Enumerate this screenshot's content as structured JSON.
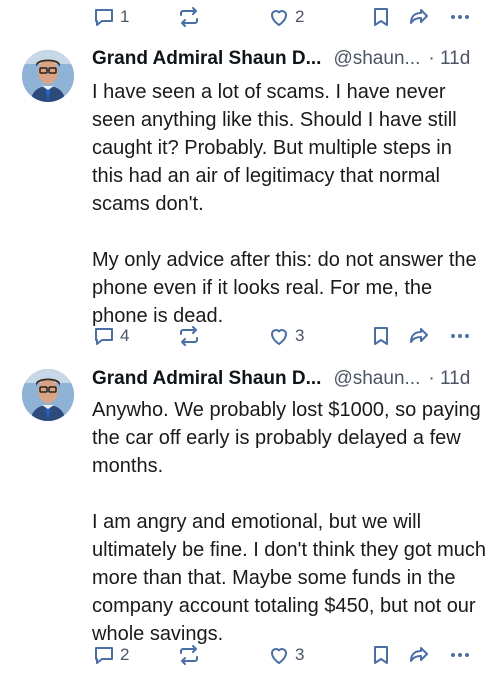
{
  "top_actions": {
    "replies": "1",
    "boosts": "",
    "favourites": "2"
  },
  "posts": [
    {
      "display_name": "Grand Admiral Shaun D...",
      "handle": "@shaun...",
      "time": "· 11d",
      "paragraphs": [
        "I have seen a lot of scams. I have never seen anything like this. Should I have still caught it? Probably. But multiple steps in this had an air of legitimacy that normal scams don't.",
        "My only advice after this: do not answer the phone even if it looks real. For me, the phone is dead."
      ],
      "actions": {
        "replies": "4",
        "favourites": "3"
      }
    },
    {
      "display_name": "Grand Admiral Shaun D...",
      "handle": "@shaun...",
      "time": "· 11d",
      "paragraphs": [
        "Anywho. We probably lost $1000, so paying the car off early is probably delayed a few months.",
        "I am angry and emotional, but we will ultimately be fine. I don't think they got much more than that. Maybe some funds in the company account totaling $450, but not our whole savings."
      ],
      "actions": {
        "replies": "2",
        "favourites": "3"
      }
    }
  ],
  "icons": {
    "reply": "reply-icon",
    "boost": "boost-icon",
    "favourite": "heart-icon",
    "bookmark": "bookmark-icon",
    "share": "share-icon",
    "more": "more-icon"
  },
  "colors": {
    "icon": "#4a6fa5",
    "muted": "#4b5563",
    "text": "#0f1419"
  }
}
